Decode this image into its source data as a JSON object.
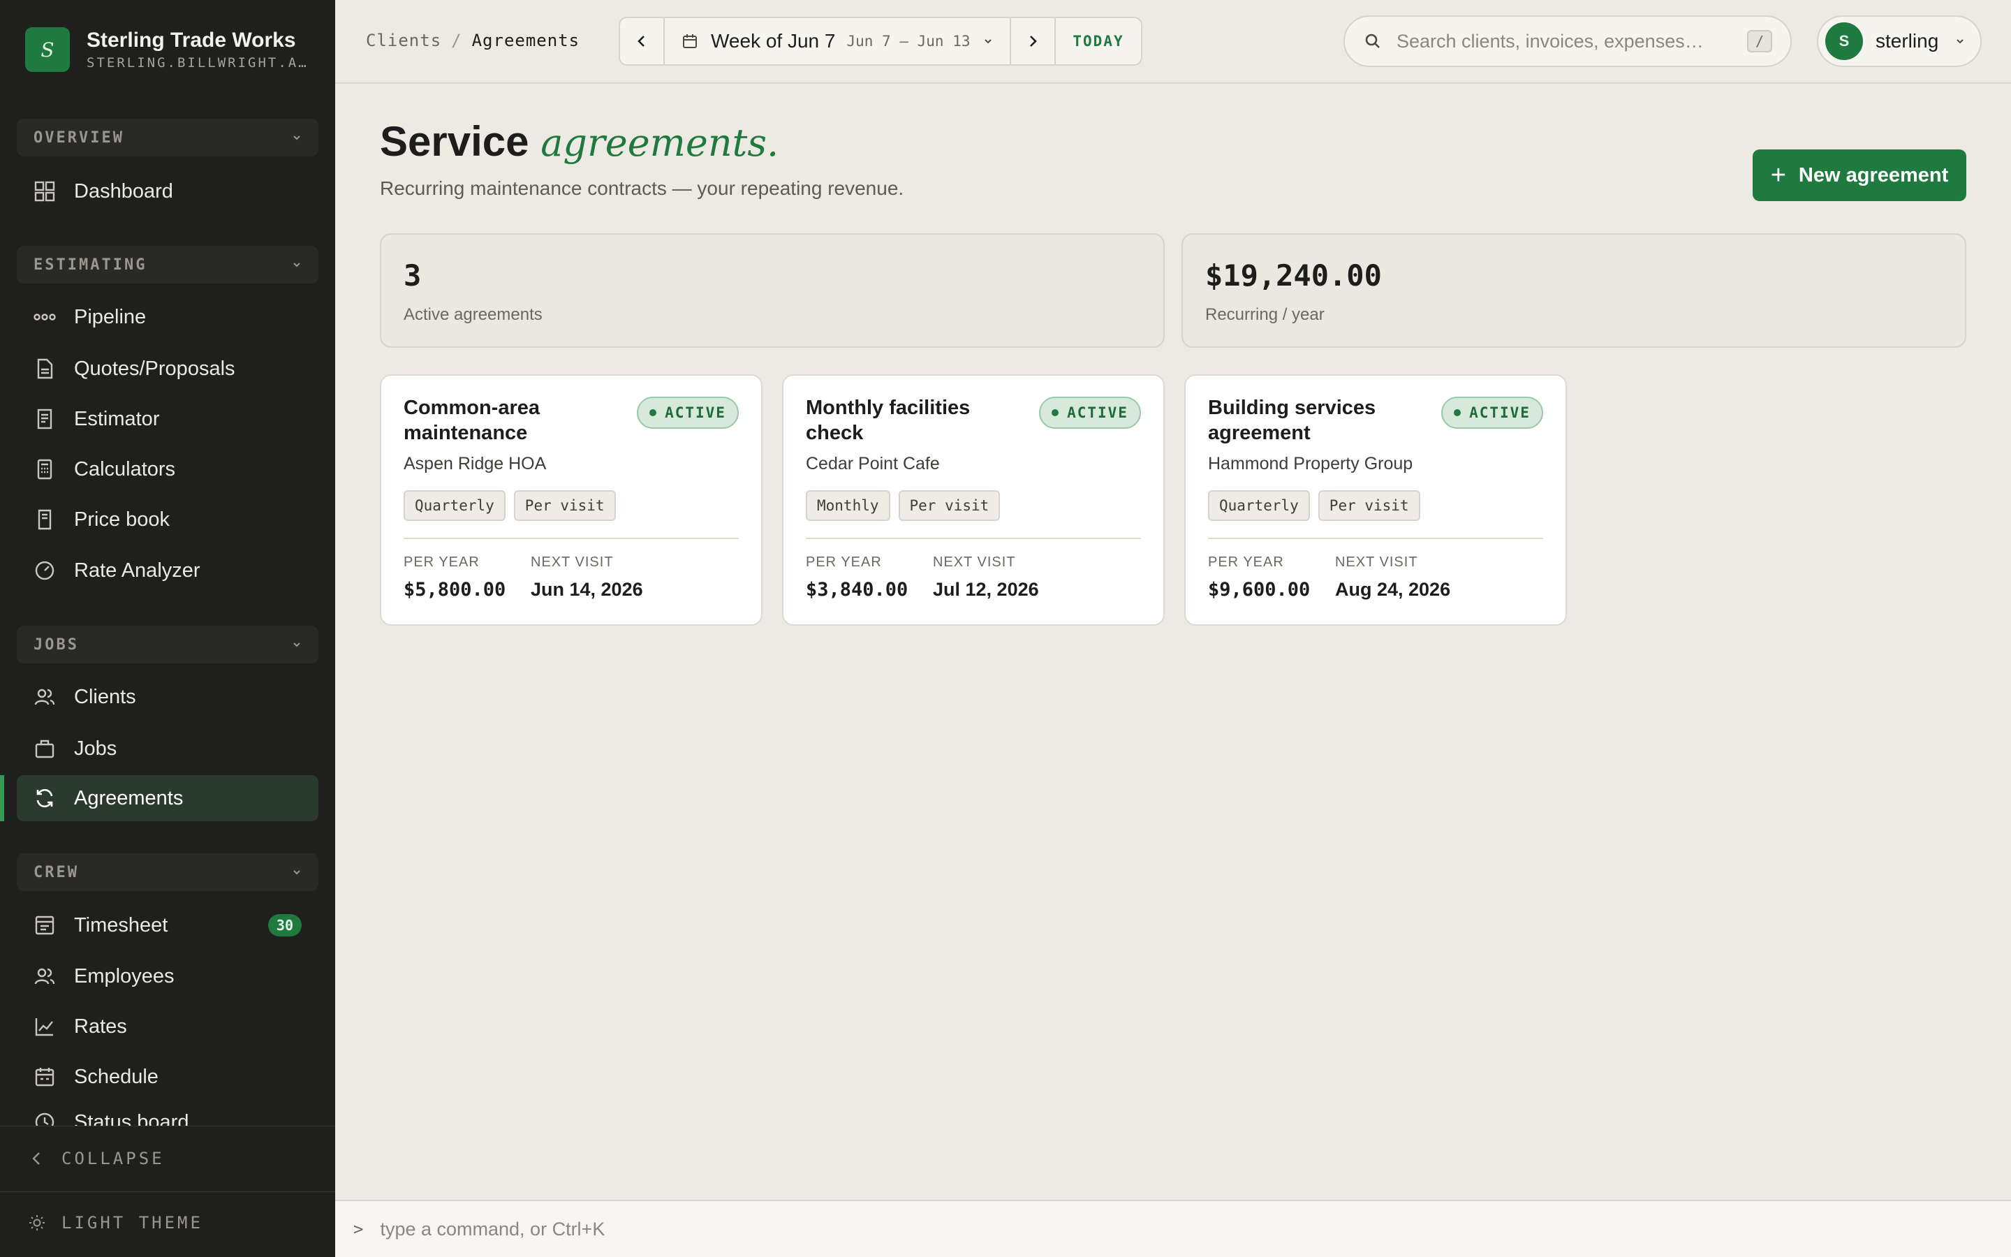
{
  "brand": {
    "name": "Sterling Trade Works",
    "subdomain": "STERLING.BILLWRIGHT.A…",
    "logo_letter": "S"
  },
  "sidebar": {
    "sections": [
      {
        "label": "OVERVIEW",
        "items": [
          {
            "label": "Dashboard",
            "icon": "grid-icon"
          }
        ]
      },
      {
        "label": "ESTIMATING",
        "items": [
          {
            "label": "Pipeline",
            "icon": "pipeline-icon"
          },
          {
            "label": "Quotes/Proposals",
            "icon": "document-icon"
          },
          {
            "label": "Estimator",
            "icon": "estimator-icon"
          },
          {
            "label": "Calculators",
            "icon": "calculator-icon"
          },
          {
            "label": "Price book",
            "icon": "book-icon"
          },
          {
            "label": "Rate Analyzer",
            "icon": "gauge-icon"
          }
        ]
      },
      {
        "label": "JOBS",
        "items": [
          {
            "label": "Clients",
            "icon": "users-icon"
          },
          {
            "label": "Jobs",
            "icon": "briefcase-icon"
          },
          {
            "label": "Agreements",
            "icon": "refresh-icon",
            "active": true
          }
        ]
      },
      {
        "label": "CREW",
        "items": [
          {
            "label": "Timesheet",
            "icon": "timesheet-icon",
            "badge": "30"
          },
          {
            "label": "Employees",
            "icon": "users-icon"
          },
          {
            "label": "Rates",
            "icon": "chart-icon"
          },
          {
            "label": "Schedule",
            "icon": "calendar-icon"
          },
          {
            "label": "Status board",
            "icon": "clock-icon"
          }
        ]
      }
    ],
    "collapse_label": "COLLAPSE",
    "theme_label": "LIGHT THEME"
  },
  "topbar": {
    "breadcrumb": [
      "Clients",
      "Agreements"
    ],
    "week_title": "Week of Jun 7",
    "week_range": "Jun 7 – Jun 13",
    "today_label": "TODAY",
    "search_placeholder": "Search clients, invoices, expenses…",
    "search_shortcut": "/",
    "user_initial": "S",
    "user_name": "sterling"
  },
  "main": {
    "title": "Service",
    "title_accent": "agreements.",
    "subtitle": "Recurring maintenance contracts — your repeating revenue.",
    "new_button": "New agreement",
    "stats": [
      {
        "value": "3",
        "label": "Active agreements"
      },
      {
        "value": "$19,240.00",
        "label": "Recurring / year"
      }
    ],
    "cards": [
      {
        "title": "Common-area maintenance",
        "status": "ACTIVE",
        "client": "Aspen Ridge HOA",
        "tags": [
          "Quarterly",
          "Per visit"
        ],
        "per_year_label": "PER YEAR",
        "per_year": "$5,800.00",
        "next_visit_label": "NEXT VISIT",
        "next_visit": "Jun 14, 2026"
      },
      {
        "title": "Monthly facilities check",
        "status": "ACTIVE",
        "client": "Cedar Point Cafe",
        "tags": [
          "Monthly",
          "Per visit"
        ],
        "per_year_label": "PER YEAR",
        "per_year": "$3,840.00",
        "next_visit_label": "NEXT VISIT",
        "next_visit": "Jul 12, 2026"
      },
      {
        "title": "Building services agreement",
        "status": "ACTIVE",
        "client": "Hammond Property Group",
        "tags": [
          "Quarterly",
          "Per visit"
        ],
        "per_year_label": "PER YEAR",
        "per_year": "$9,600.00",
        "next_visit_label": "NEXT VISIT",
        "next_visit": "Aug 24, 2026"
      }
    ]
  },
  "command_bar": {
    "prompt": ">",
    "placeholder": "type a command, or Ctrl+K"
  },
  "colors": {
    "accent": "#1f7a3f",
    "sidebar_bg": "#1f1f1e",
    "page_bg": "#edeae3",
    "status_bg": "#d6e9da"
  }
}
